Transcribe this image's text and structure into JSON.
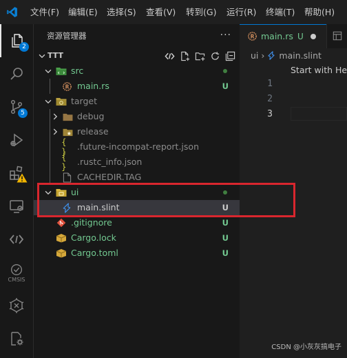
{
  "menu": [
    "文件(F)",
    "编辑(E)",
    "选择(S)",
    "查看(V)",
    "转到(G)",
    "运行(R)",
    "终端(T)",
    "帮助(H)"
  ],
  "activity_bar": {
    "explorer_badge": "2",
    "source_control_badge": "5",
    "cmsis_label": "CMSIS"
  },
  "sidebar": {
    "title": "资源管理器",
    "more": "···",
    "section_title": "TTT",
    "tree": [
      {
        "label": "src",
        "status": "dot"
      },
      {
        "label": "main.rs",
        "status": "U"
      },
      {
        "label": "target",
        "status": ""
      },
      {
        "label": "debug",
        "status": ""
      },
      {
        "label": "release",
        "status": ""
      },
      {
        "label": ".future-incompat-report.json",
        "status": ""
      },
      {
        "label": ".rustc_info.json",
        "status": ""
      },
      {
        "label": "CACHEDIR.TAG",
        "status": ""
      },
      {
        "label": "ui",
        "status": "dot"
      },
      {
        "label": "main.slint",
        "status": "U"
      },
      {
        "label": ".gitignore",
        "status": "U"
      },
      {
        "label": "Cargo.lock",
        "status": "U"
      },
      {
        "label": "Cargo.toml",
        "status": "U"
      }
    ]
  },
  "tab": {
    "label": "main.rs",
    "status": "U"
  },
  "breadcrumb": {
    "folder": "ui",
    "file": "main.slint"
  },
  "editor": {
    "hint": "Start with Hel",
    "line_numbers": [
      "1",
      "2",
      "3"
    ]
  },
  "watermark": "CSDN @小灰灰搞电子",
  "colors": {
    "accent": "#0078d4",
    "untracked": "#73c991",
    "highlight_box": "#d9262e"
  }
}
